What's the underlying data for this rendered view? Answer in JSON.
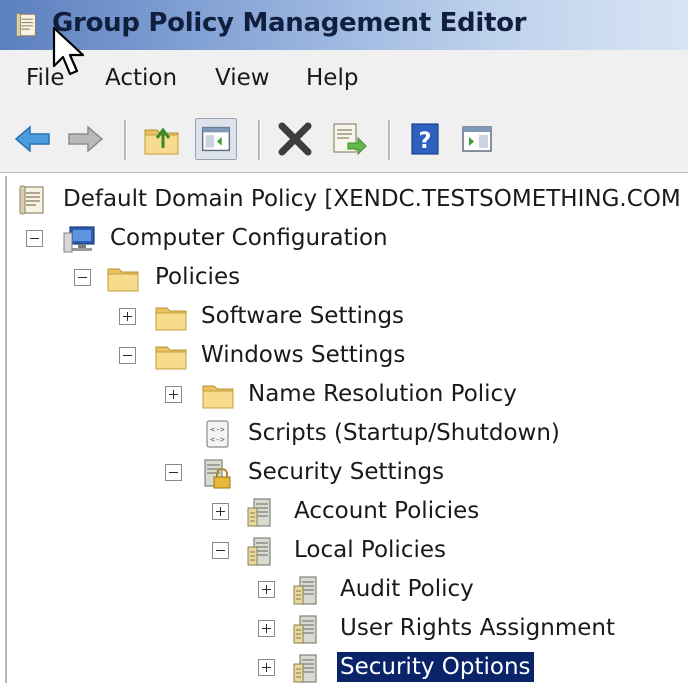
{
  "window": {
    "title": "Group Policy Management Editor"
  },
  "menu": {
    "items": [
      "File",
      "Action",
      "View",
      "Help"
    ]
  },
  "toolbar": {
    "buttons": [
      "back-arrow-icon",
      "forward-arrow-icon",
      "up-folder-icon",
      "show-hide-console-tree-icon",
      "delete-icon",
      "export-list-icon",
      "help-icon",
      "show-action-pane-icon"
    ]
  },
  "tree": {
    "root": "Default Domain Policy [XENDC.TESTSOMETHING.COM",
    "computer_configuration": "Computer Configuration",
    "policies": "Policies",
    "software_settings": "Software Settings",
    "windows_settings": "Windows Settings",
    "name_resolution_policy": "Name Resolution Policy",
    "scripts": "Scripts (Startup/Shutdown)",
    "security_settings": "Security Settings",
    "account_policies": "Account Policies",
    "local_policies": "Local Policies",
    "audit_policy": "Audit Policy",
    "user_rights_assignment": "User Rights Assignment",
    "security_options": "Security Options"
  },
  "colors": {
    "selection": "#0a246a",
    "title_gradient_start": "#5c7fbf",
    "folder": "#f2d27a"
  }
}
